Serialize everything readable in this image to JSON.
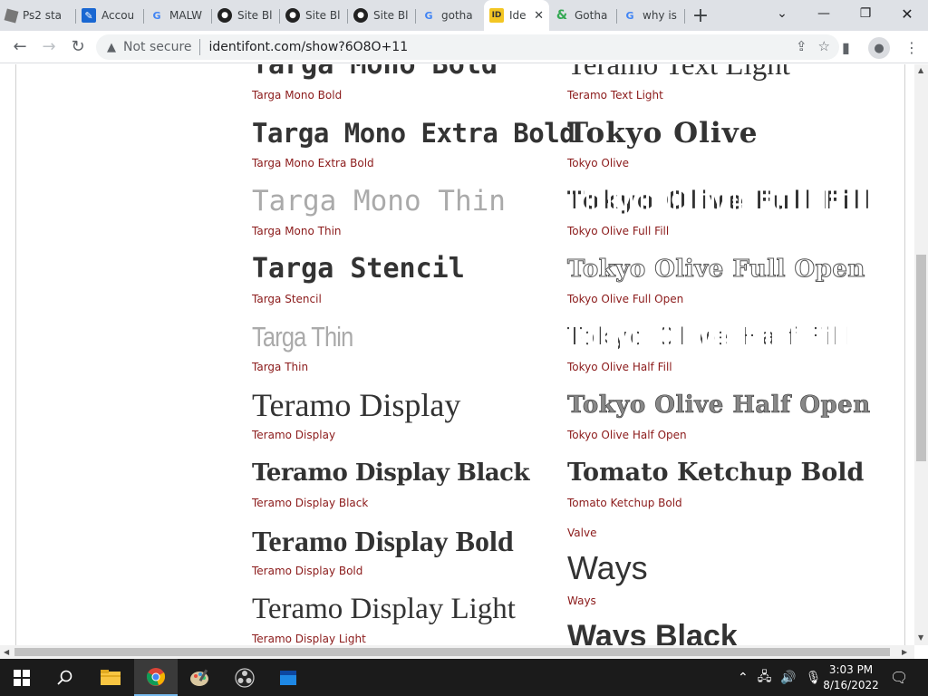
{
  "browser": {
    "tabs": [
      {
        "label": "Ps2 sta",
        "icon": "roblox-icon"
      },
      {
        "label": "Accou",
        "icon": "pencil-icon"
      },
      {
        "label": "MALW",
        "icon": "google-icon"
      },
      {
        "label": "Site Bl",
        "icon": "github-icon"
      },
      {
        "label": "Site Bl",
        "icon": "github-icon"
      },
      {
        "label": "Site Bl",
        "icon": "github-icon"
      },
      {
        "label": "gotha",
        "icon": "google-icon"
      },
      {
        "label": "Ide",
        "icon": "identifont-icon",
        "active": true
      },
      {
        "label": "Gotha",
        "icon": "ampersand-icon"
      },
      {
        "label": "why is",
        "icon": "google-icon"
      }
    ],
    "new_tab": "+",
    "security_label": "Not secure",
    "url": "identifont.com/show?6O8O+11"
  },
  "fonts_left": [
    {
      "sample": "Targa Mono Bold",
      "name": "Targa Mono Bold"
    },
    {
      "sample": "Targa Mono Extra Bold",
      "name": "Targa Mono Extra Bold"
    },
    {
      "sample": "Targa Mono Thin",
      "name": "Targa Mono Thin"
    },
    {
      "sample": "Targa Stencil",
      "name": "Targa Stencil"
    },
    {
      "sample": "Targa Thin",
      "name": "Targa Thin"
    },
    {
      "sample": "Teramo Display",
      "name": "Teramo Display"
    },
    {
      "sample": "Teramo Display Black",
      "name": "Teramo Display Black"
    },
    {
      "sample": "Teramo Display Bold",
      "name": "Teramo Display Bold"
    },
    {
      "sample": "Teramo Display Light",
      "name": "Teramo Display Light"
    }
  ],
  "fonts_right": [
    {
      "sample": "Teramo Text Light",
      "name": "Teramo Text Light"
    },
    {
      "sample": "Tokyo Olive",
      "name": "Tokyo Olive"
    },
    {
      "sample": "Tokyo Olive Full Fill",
      "name": "Tokyo Olive Full Fill"
    },
    {
      "sample": "Tokyo Olive Full Open",
      "name": "Tokyo Olive Full Open"
    },
    {
      "sample": "Tokyo Olive Half Fill",
      "name": "Tokyo Olive Half Fill"
    },
    {
      "sample": "Tokyo Olive Half Open",
      "name": "Tokyo Olive Half Open"
    },
    {
      "sample": "Tomato Ketchup Bold",
      "name": "Tomato Ketchup Bold"
    },
    {
      "sample": "",
      "name": "Valve"
    },
    {
      "sample": "Ways",
      "name": "Ways"
    },
    {
      "sample": "Ways Black",
      "name": ""
    }
  ],
  "taskbar": {
    "time": "3:03 PM",
    "date": "8/16/2022"
  },
  "colors": {
    "font_name_link": "#8b1a1a",
    "sample_text": "#333333",
    "tabstrip_bg": "#dee1e6"
  }
}
